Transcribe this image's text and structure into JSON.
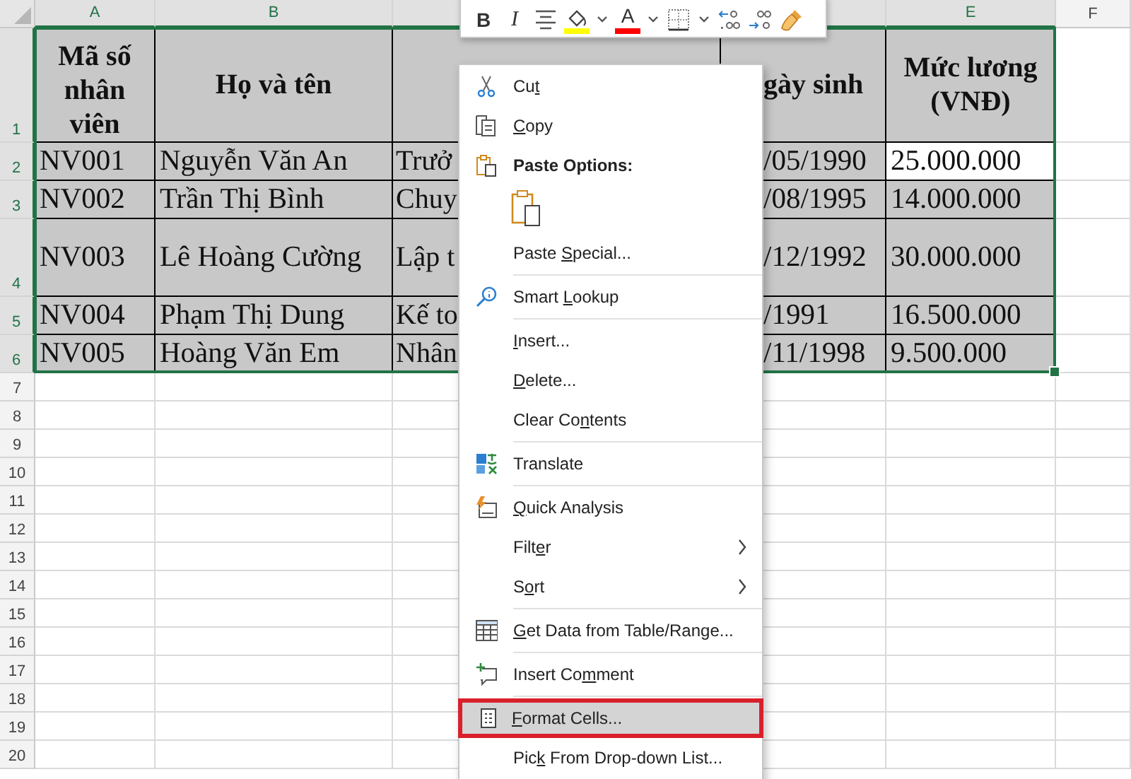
{
  "toolbar": {
    "buttons": [
      {
        "kind": "bold",
        "label": "B"
      },
      {
        "kind": "italic",
        "label": "I"
      },
      {
        "kind": "align"
      },
      {
        "kind": "fill",
        "color": "#ffff00"
      },
      {
        "kind": "caret"
      },
      {
        "kind": "font_color",
        "label": "A",
        "color": "#ff0000"
      },
      {
        "kind": "caret"
      },
      {
        "kind": "borders"
      },
      {
        "kind": "caret"
      },
      {
        "kind": "increase_decimal"
      },
      {
        "kind": "decrease_decimal"
      },
      {
        "kind": "painter"
      }
    ]
  },
  "sheet": {
    "columns": [
      {
        "letter": "A",
        "selected": true
      },
      {
        "letter": "B",
        "selected": true
      },
      {
        "selected": true
      },
      {
        "selected": true
      },
      {
        "letter": "E",
        "selected": true
      },
      {
        "letter": "F",
        "selected": false
      }
    ],
    "rows": [
      {
        "number": "1",
        "selected": true,
        "kind": "header",
        "cells": [
          {
            "text": "Mã số nhân viên",
            "active": false
          },
          {
            "text": "Họ và tên",
            "active": false
          },
          {
            "active": false
          },
          {
            "text": "gày sinh",
            "active": false
          },
          {
            "text": "Mức lương (VNĐ)",
            "active": false
          }
        ]
      },
      {
        "number": "2",
        "selected": true,
        "kind": "data",
        "cells": [
          {
            "text": "NV001",
            "active": false
          },
          {
            "text": "Nguyễn Văn An",
            "active": false
          },
          {
            "text": "Trưở",
            "active": false
          },
          {
            "text": "/05/1990",
            "active": false
          },
          {
            "text": "25.000.000",
            "active": true
          }
        ]
      },
      {
        "number": "3",
        "selected": true,
        "kind": "data",
        "cells": [
          {
            "text": "NV002",
            "active": false
          },
          {
            "text": "Trần Thị Bình",
            "active": false
          },
          {
            "text": "Chuy",
            "active": false
          },
          {
            "text": "/08/1995",
            "active": false
          },
          {
            "text": "14.000.000",
            "active": false
          }
        ]
      },
      {
        "number": "4",
        "selected": true,
        "kind": "data",
        "cells": [
          {
            "text": "NV003",
            "active": false
          },
          {
            "text": "Lê Hoàng Cường",
            "active": false
          },
          {
            "text": "Lập t",
            "active": false
          },
          {
            "text": "/12/1992",
            "active": false
          },
          {
            "text": "30.000.000",
            "active": false
          }
        ]
      },
      {
        "number": "5",
        "selected": true,
        "kind": "data",
        "cells": [
          {
            "text": "NV004",
            "active": false
          },
          {
            "text": "Phạm Thị Dung",
            "active": false
          },
          {
            "text": "Kế to",
            "active": false
          },
          {
            "text": "/1991",
            "active": false
          },
          {
            "text": "16.500.000",
            "active": false
          }
        ]
      },
      {
        "number": "6",
        "selected": true,
        "kind": "data",
        "cells": [
          {
            "text": "NV005",
            "active": false
          },
          {
            "text": "Hoàng Văn Em",
            "active": false
          },
          {
            "text": "Nhân",
            "active": false
          },
          {
            "text": "/11/1998",
            "active": false
          },
          {
            "text": "9.500.000",
            "active": false
          }
        ]
      }
    ],
    "empty_rows": [
      "7",
      "8",
      "9",
      "10",
      "11",
      "12",
      "13",
      "14",
      "15",
      "16",
      "17",
      "18",
      "19",
      "20"
    ]
  },
  "context_menu": {
    "items": [
      {
        "kind": "command",
        "before": "Cu",
        "key": "t",
        "highlighted": false,
        "marked": false
      },
      {
        "kind": "command",
        "key": "C",
        "after": "opy",
        "highlighted": false,
        "marked": false
      },
      {
        "kind": "heading",
        "before": "Paste Options:"
      },
      {
        "kind": "paste_button"
      },
      {
        "kind": "command",
        "before": "Paste ",
        "key": "S",
        "after": "pecial...",
        "highlighted": false,
        "marked": false
      },
      {
        "kind": "separator"
      },
      {
        "kind": "command",
        "before": "Smart ",
        "key": "L",
        "after": "ookup",
        "highlighted": false,
        "marked": false
      },
      {
        "kind": "separator"
      },
      {
        "kind": "command",
        "key": "I",
        "after": "nsert...",
        "highlighted": false,
        "marked": false
      },
      {
        "kind": "command",
        "key": "D",
        "after": "elete...",
        "highlighted": false,
        "marked": false
      },
      {
        "kind": "command",
        "before": "Clear Co",
        "key": "n",
        "after": "tents",
        "highlighted": false,
        "marked": false
      },
      {
        "kind": "separator"
      },
      {
        "kind": "command",
        "before": "Translate",
        "highlighted": false,
        "marked": false
      },
      {
        "kind": "separator"
      },
      {
        "kind": "command",
        "key": "Q",
        "after": "uick Analysis",
        "highlighted": false,
        "marked": false
      },
      {
        "kind": "command",
        "before": "Filt",
        "key": "e",
        "after": "r",
        "submenu": true,
        "highlighted": false,
        "marked": false
      },
      {
        "kind": "command",
        "before": "S",
        "key": "o",
        "after": "rt",
        "submenu": true,
        "highlighted": false,
        "marked": false
      },
      {
        "kind": "separator"
      },
      {
        "kind": "command",
        "key": "G",
        "after": "et Data from Table/Range...",
        "highlighted": false,
        "marked": false
      },
      {
        "kind": "separator"
      },
      {
        "kind": "command",
        "before": "Insert Co",
        "key": "m",
        "after": "ment",
        "highlighted": false,
        "marked": false
      },
      {
        "kind": "separator"
      },
      {
        "kind": "command",
        "key": "F",
        "after": "ormat Cells...",
        "highlighted": true,
        "marked": true
      },
      {
        "kind": "command",
        "before": "Pic",
        "key": "k",
        "after": " From Drop-down List...",
        "highlighted": false,
        "marked": false
      }
    ]
  }
}
